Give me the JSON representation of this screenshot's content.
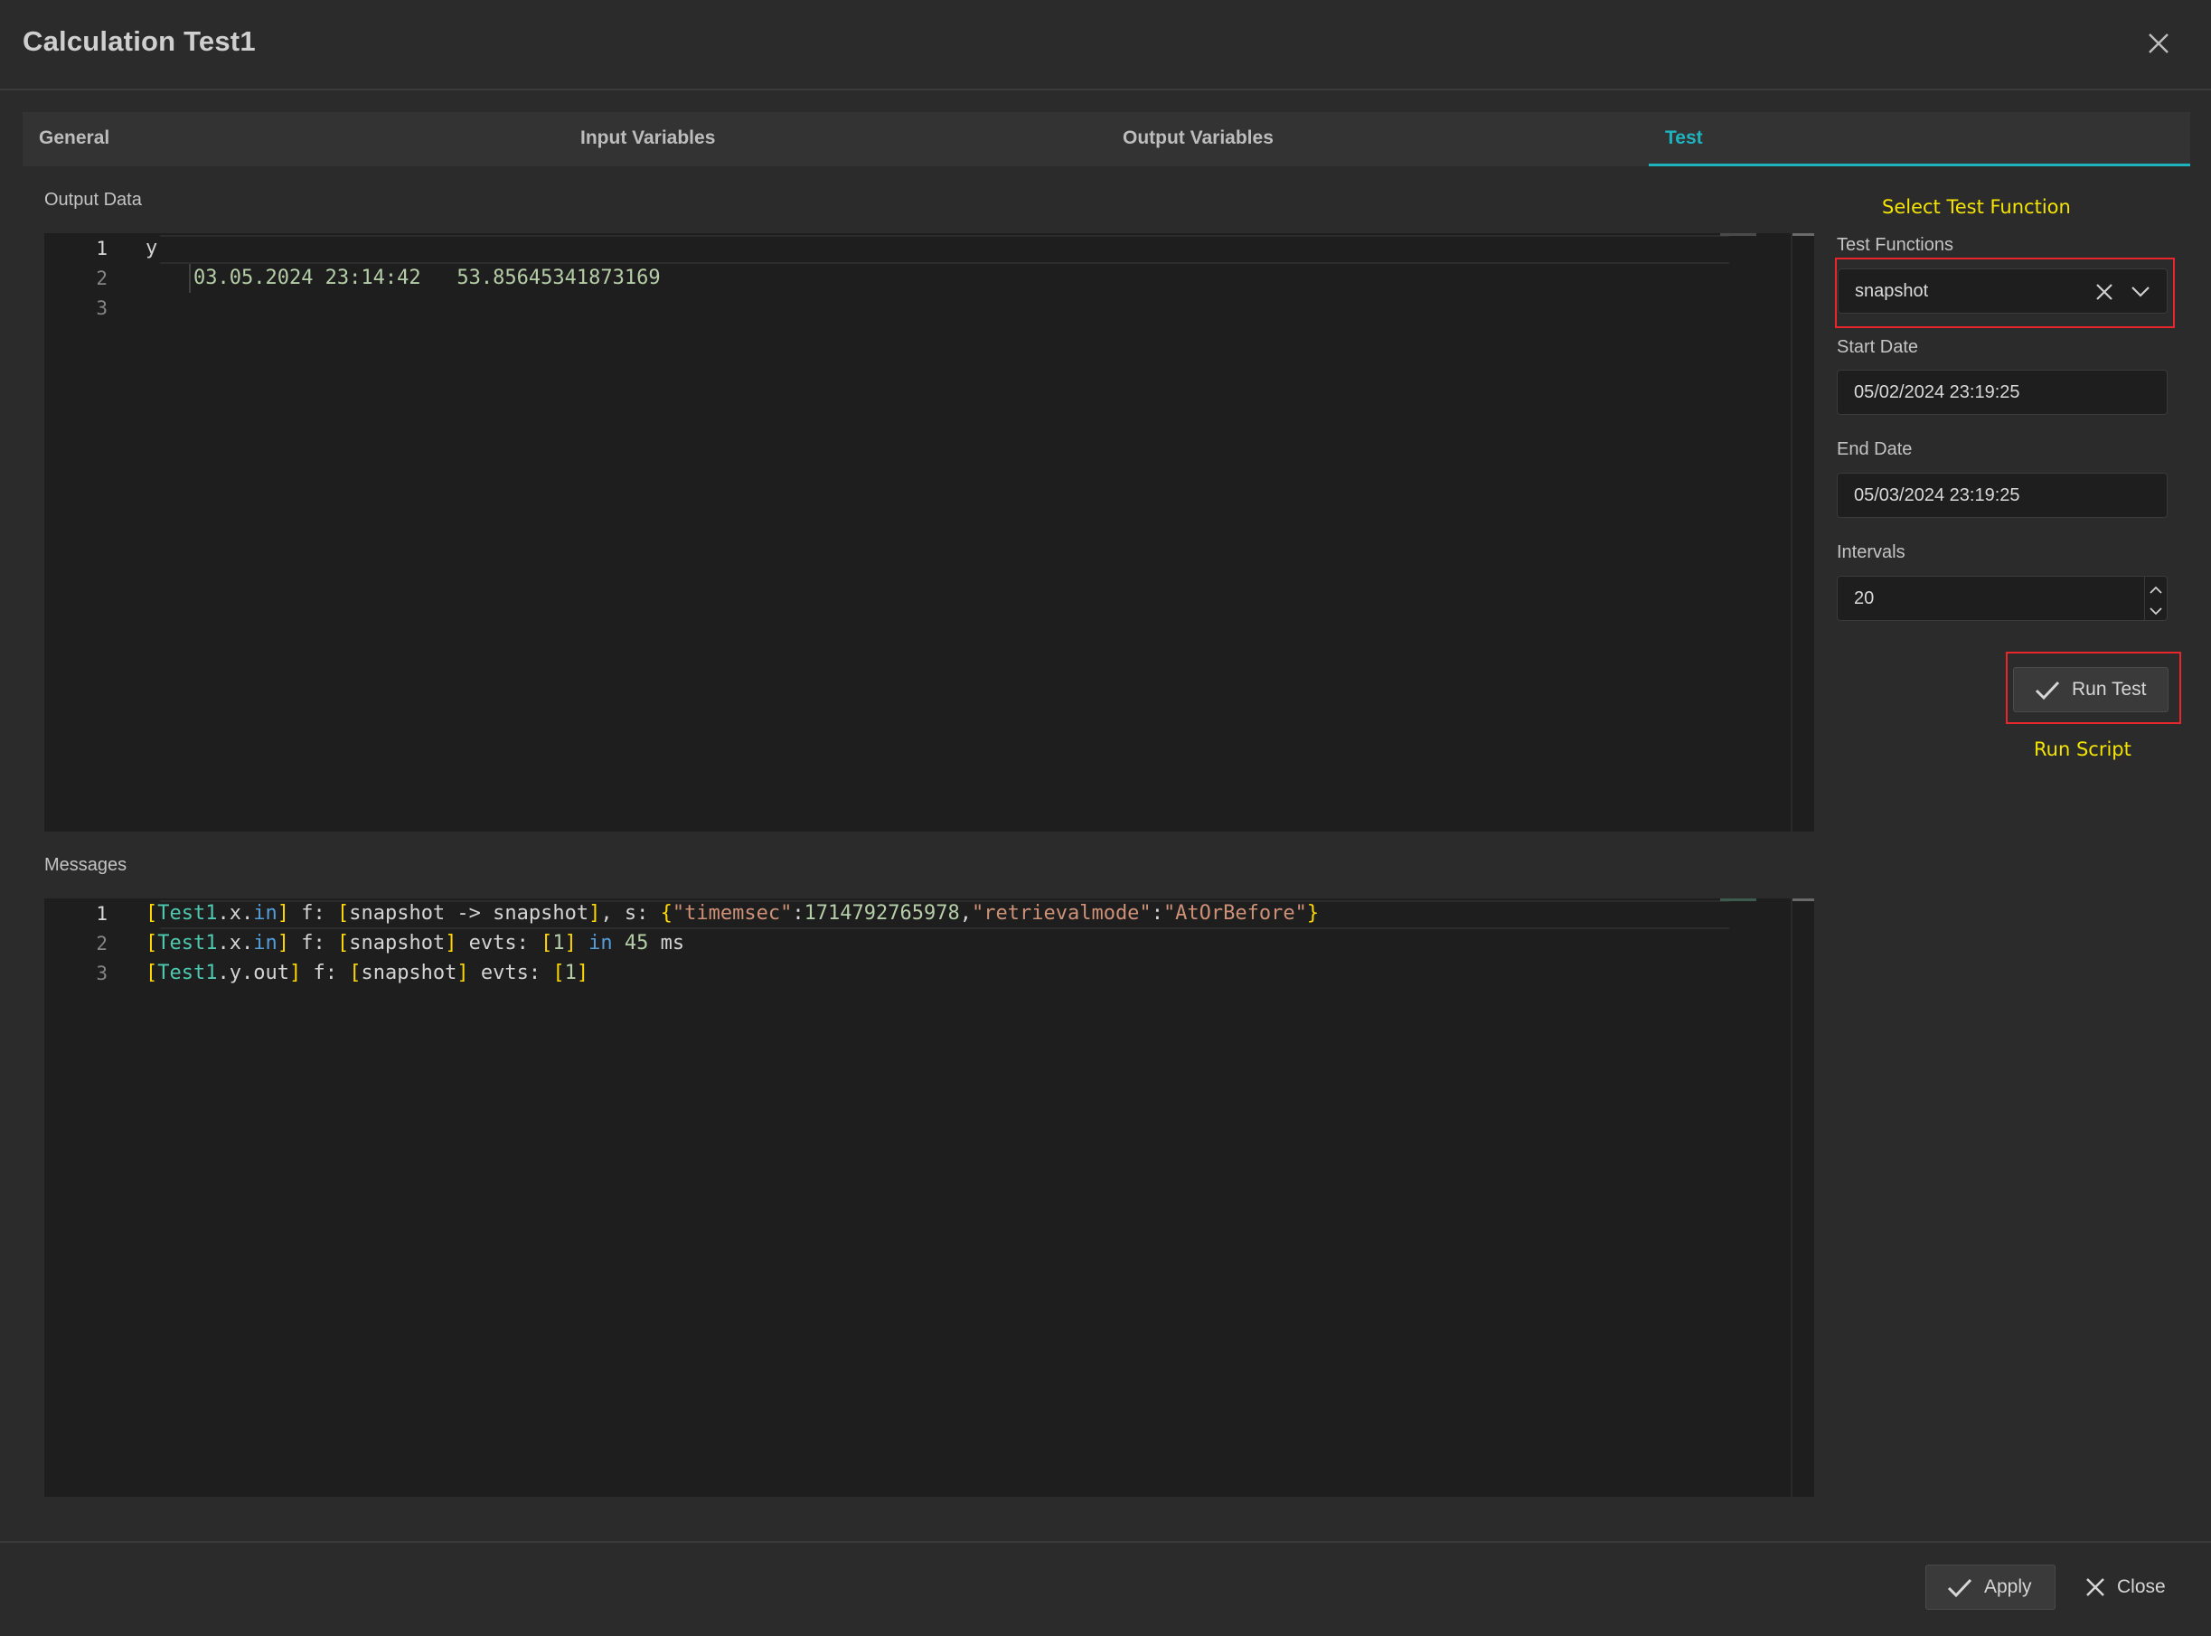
{
  "dialog": {
    "title": "Calculation Test1"
  },
  "tabs": [
    {
      "label": "General"
    },
    {
      "label": "Input Variables"
    },
    {
      "label": "Output Variables"
    },
    {
      "label": "Test"
    }
  ],
  "output_data": {
    "label": "Output Data",
    "line_numbers": [
      "1",
      "2",
      "3"
    ],
    "lines": [
      {
        "header": "y"
      },
      {
        "date": "03.05.2024 23:14:42",
        "value": "53.85645341873169"
      },
      {
        "text": ""
      }
    ]
  },
  "messages": {
    "label": "Messages",
    "line_numbers": [
      "1",
      "2",
      "3"
    ],
    "line1": {
      "open": "[",
      "obj": "Test1",
      "dot1": ".x.",
      "kw": "in",
      "close": "]",
      "f": " f: ",
      "b_open": "[",
      "func": "snapshot -> snapshot",
      "b_close": "]",
      "s": ", s: ",
      "c_open": "{",
      "k1": "\"timemsec\"",
      "colon1": ":",
      "v1": "1714792765978",
      "comma": ",",
      "k2": "\"retrievalmode\"",
      "colon2": ":",
      "v2": "\"AtOrBefore\"",
      "c_close": "}"
    },
    "line2": {
      "open": "[",
      "obj": "Test1",
      "dot1": ".x.",
      "kw": "in",
      "close": "]",
      "f": " f: ",
      "b_open": "[",
      "func": "snapshot",
      "b_close": "]",
      "evts": " evts: ",
      "e_open": "[",
      "count": "1",
      "e_close": "]",
      "in_kw": " in ",
      "ms_val": "45",
      "ms": " ms"
    },
    "line3": {
      "open": "[",
      "obj": "Test1",
      "dot1": ".y.out",
      "close": "]",
      "f": " f: ",
      "b_open": "[",
      "func": "snapshot",
      "b_close": "]",
      "evts": " evts: ",
      "e_open": "[",
      "count": "1",
      "e_close": "]"
    }
  },
  "panel": {
    "annotation_select": "Select Test Function",
    "test_functions_label": "Test Functions",
    "test_function_value": "snapshot",
    "start_date_label": "Start Date",
    "start_date_value": "05/02/2024 23:19:25",
    "end_date_label": "End Date",
    "end_date_value": "05/03/2024 23:19:25",
    "intervals_label": "Intervals",
    "intervals_value": "20",
    "run_test_label": "Run Test",
    "annotation_run": "Run Script"
  },
  "footer": {
    "apply_label": "Apply",
    "close_label": "Close"
  },
  "colors": {
    "accent": "#1fb3bf",
    "annotation": "#f5e400",
    "highlight_box": "#e8262b"
  },
  "icons": [
    "close-icon",
    "clear-icon",
    "chevron-down-icon",
    "chevron-up-icon",
    "check-icon"
  ]
}
